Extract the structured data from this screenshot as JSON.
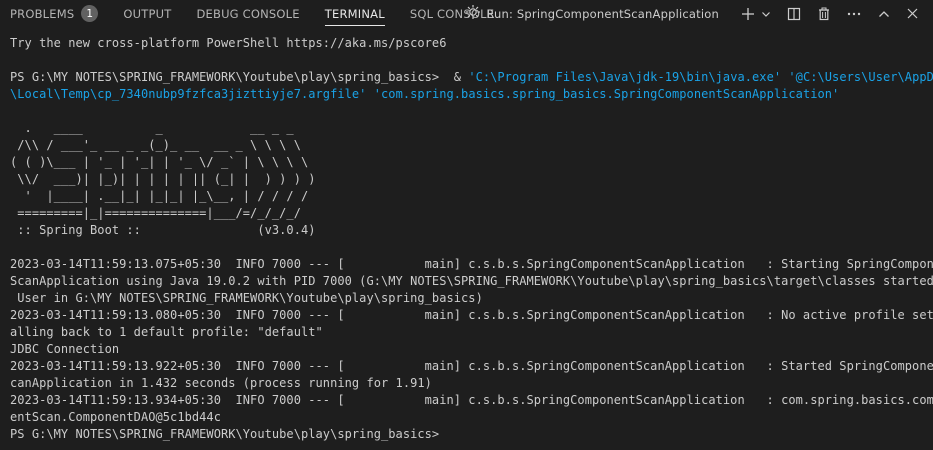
{
  "tabs": [
    {
      "label": "PROBLEMS",
      "badge": "1"
    },
    {
      "label": "OUTPUT"
    },
    {
      "label": "DEBUG CONSOLE"
    },
    {
      "label": "TERMINAL",
      "active": true
    },
    {
      "label": "SQL CONSOLE"
    }
  ],
  "run": {
    "label": "Run: SpringComponentScanApplication"
  },
  "colors": {
    "bg": "#1e1e1e",
    "text": "#cccccc",
    "string": "#1aa2e6",
    "badge": "#616161"
  },
  "terminal": {
    "ps_notice": "Try the new cross-platform PowerShell https://aka.ms/pscore6",
    "cmd": {
      "prompt": "PS G:\\MY NOTES\\SPRING_FRAMEWORK\\Youtube\\play\\spring_basics>  & ",
      "arg1": "'C:\\Program Files\\Java\\jdk-19\\bin\\java.exe'",
      "arg2a": "'@C:\\Users\\User\\AppData",
      "arg2b": "\\Local\\Temp\\cp_7340nubp9fzfca3jizttiyje7.argfile'",
      "arg3": "'com.spring.basics.spring_basics.SpringComponentScanApplication'"
    },
    "banner": [
      "  .   ____          _            __ _ _",
      " /\\\\ / ___'_ __ _ _(_)_ __  __ _ \\ \\ \\ \\",
      "( ( )\\___ | '_ | '_| | '_ \\/ _` | \\ \\ \\ \\",
      " \\\\/  ___)| |_)| | | | | || (_| |  ) ) ) )",
      "  '  |____| .__|_| |_|_| |_\\__, | / / / /",
      " =========|_|==============|___/=/_/_/_/",
      " :: Spring Boot ::                (v3.0.4)"
    ],
    "log": [
      "2023-03-14T11:59:13.075+05:30  INFO 7000 --- [           main] c.s.b.s.SpringComponentScanApplication   : Starting SpringComponent",
      "ScanApplication using Java 19.0.2 with PID 7000 (G:\\MY NOTES\\SPRING_FRAMEWORK\\Youtube\\play\\spring_basics\\target\\classes started by",
      " User in G:\\MY NOTES\\SPRING_FRAMEWORK\\Youtube\\play\\spring_basics)",
      "2023-03-14T11:59:13.080+05:30  INFO 7000 --- [           main] c.s.b.s.SpringComponentScanApplication   : No active profile set, f",
      "alling back to 1 default profile: \"default\"",
      "JDBC Connection",
      "2023-03-14T11:59:13.922+05:30  INFO 7000 --- [           main] c.s.b.s.SpringComponentScanApplication   : Started SpringComponentS",
      "canApplication in 1.432 seconds (process running for 1.91)",
      "2023-03-14T11:59:13.934+05:30  INFO 7000 --- [           main] c.s.b.s.SpringComponentScanApplication   : com.spring.basics.compon",
      "entScan.ComponentDAO@5c1bd44c"
    ],
    "final_prompt": "PS G:\\MY NOTES\\SPRING_FRAMEWORK\\Youtube\\play\\spring_basics>"
  }
}
